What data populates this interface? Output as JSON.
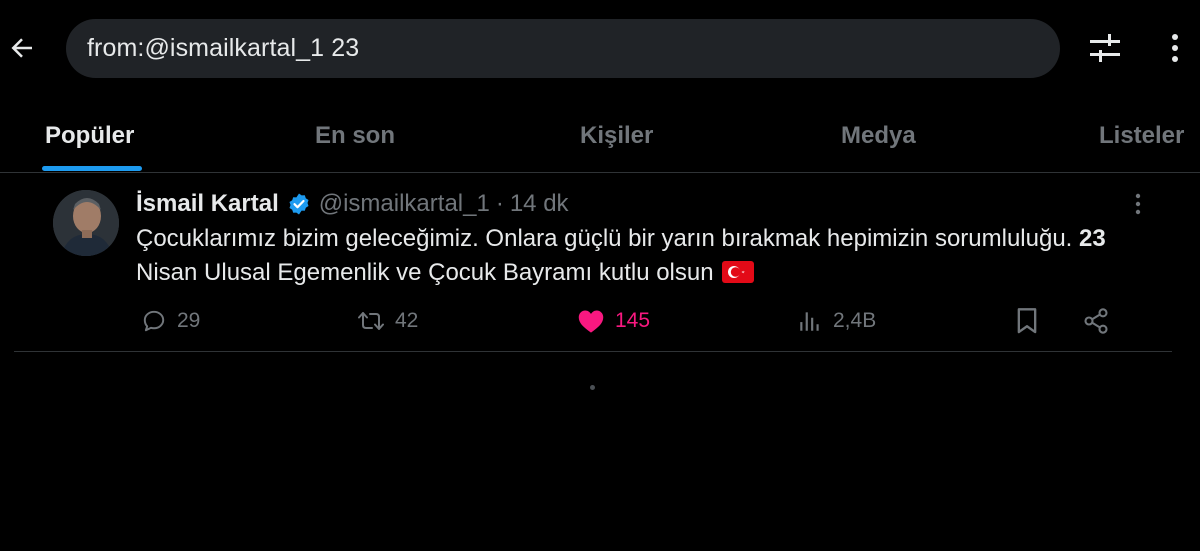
{
  "header": {
    "search_value": "from:@ismailkartal_1 23",
    "back_icon": "arrow-left-icon",
    "filter_icon": "sliders-icon",
    "more_icon": "more-vertical-icon"
  },
  "tabs": [
    {
      "label": "Popüler",
      "active": true
    },
    {
      "label": "En son",
      "active": false
    },
    {
      "label": "Kişiler",
      "active": false
    },
    {
      "label": "Medya",
      "active": false
    },
    {
      "label": "Listeler",
      "active": false
    }
  ],
  "tweet": {
    "author_name": "İsmail Kartal",
    "handle": "@ismailkartal_1",
    "separator": "·",
    "time": "14 dk",
    "text_part1": "Çocuklarımız bizim geleceğimiz. Onlara güçlü bir yarın bırakmak hepimizin sorumluluğu. ",
    "text_bold": "23",
    "text_part2": " Nisan Ulusal Egemenlik ve Çocuk Bayramı kutlu olsun ",
    "replies": "29",
    "retweets": "42",
    "likes": "145",
    "views": "2,4B"
  },
  "colors": {
    "accent": "#1d9bf0",
    "like": "#f91880",
    "muted": "#71767b",
    "background": "#000000",
    "search_bg": "#202327"
  }
}
